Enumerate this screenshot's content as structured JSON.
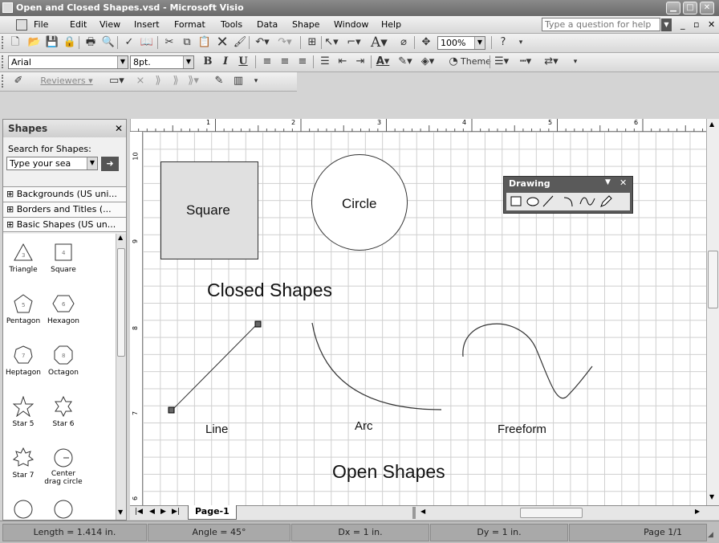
{
  "window": {
    "title": "Open and Closed Shapes.vsd - Microsoft Visio"
  },
  "menu": {
    "items": [
      "File",
      "Edit",
      "View",
      "Insert",
      "Format",
      "Tools",
      "Data",
      "Shape",
      "Window",
      "Help"
    ],
    "help_placeholder": "Type a question for help"
  },
  "toolbar": {
    "zoom": "100%",
    "theme_label": "Theme"
  },
  "format": {
    "font": "Arial",
    "size": "8pt.",
    "bold": "B",
    "italic": "I",
    "underline": "U"
  },
  "reviewing": {
    "reviewers": "Reviewers"
  },
  "shapes": {
    "title": "Shapes",
    "search_label": "Search for Shapes:",
    "search_placeholder": "Type your sea",
    "stencils": [
      "Backgrounds (US uni...",
      "Borders and Titles (...",
      "Basic Shapes (US un..."
    ],
    "items": [
      "Triangle",
      "Square",
      "Pentagon",
      "Hexagon",
      "Heptagon",
      "Octagon",
      "Star 5",
      "Star 6",
      "Star 7",
      "Center drag circle"
    ]
  },
  "drawing_toolbar": {
    "title": "Drawing"
  },
  "canvas": {
    "square": "Square",
    "circle": "Circle",
    "closed_title": "Closed Shapes",
    "line": "Line",
    "arc": "Arc",
    "freeform": "Freeform",
    "open_title": "Open Shapes"
  },
  "ruler": {
    "top": [
      "1",
      "2",
      "3",
      "4",
      "5",
      "6"
    ],
    "left": [
      "10",
      "9",
      "8",
      "7",
      "6"
    ]
  },
  "tabs": {
    "page": "Page-1"
  },
  "status": {
    "length": "Length = 1.414 in.",
    "angle": "Angle = 45°",
    "dx": "Dx = 1 in.",
    "dy": "Dy = 1 in.",
    "page": "Page 1/1"
  }
}
